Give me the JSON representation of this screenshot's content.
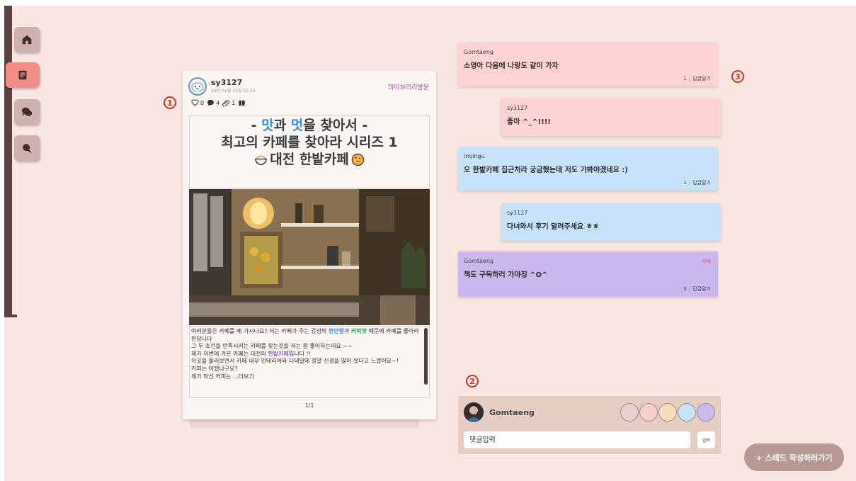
{
  "sidebar": {
    "items": [
      {
        "icon": "home-icon",
        "active": false
      },
      {
        "icon": "document-icon",
        "active": true
      },
      {
        "icon": "chat-icon",
        "active": false
      },
      {
        "icon": "search-icon",
        "active": false
      }
    ]
  },
  "post": {
    "user": "sy3127",
    "date": "24년 02월 15일 15:24",
    "visit_label": "마이브러리방문",
    "stats": {
      "likes": "0",
      "comments": "4",
      "clips": "1"
    },
    "title": {
      "line1_pre": "- ",
      "line1_mat": "맛",
      "line1_mid": "과 ",
      "line1_meot": "멋",
      "line1_post": "을 찾아서 -",
      "line2": "최고의 카페를 찾아라 시리즈 1",
      "line3": "대전 한밭카페"
    },
    "body": {
      "p1_a": "여러분들은 카페를 왜 가시나요? 저는 카페가 주는 감성의 ",
      "p1_b": "편안함",
      "p1_c": "과 ",
      "p1_d": "커피맛",
      "p1_e": " 때문에 카페를 좋아라 한답니다",
      "p2": "그 두 조건을 만족시키는 카페를 찾는것을 저는 참 좋아하는데요 ~~",
      "p3_a": "제가 이번에 가본 카페는 대전의 ",
      "p3_b": "한밭카페",
      "p3_c": "입니다 !!",
      "p4": "이곳을 둘러보면서 카페 내부 인테리어와 디테일에 정말 신경을 많이 썼다고 느꼈어요~!",
      "p5": "커피는 어땠냐구요?",
      "p6": "제가 마신 커피는 ...더보기"
    },
    "pages": "1/1"
  },
  "markers": {
    "m1": "1",
    "m2": "2",
    "m3": "3"
  },
  "comments": [
    {
      "user": "Gomtaeng",
      "text": "소영아 다음에 나랑도 같이 가자",
      "count": "1",
      "reply": "답글달기"
    },
    {
      "user": "sy3127",
      "text": "좋아 ^_^!!!!"
    },
    {
      "user": "imjingu",
      "text": "오 한밭카페 집근처라 궁금했는데 저도 가봐야겠네요 :)",
      "count": "1",
      "reply": "답글달기"
    },
    {
      "user": "sy3127",
      "text": "다녀와서 후기 알려주세요 ㅎㅎ"
    },
    {
      "user": "Gomtaeng",
      "text": "책도 구독하러 가야징 ^O^",
      "count": "0",
      "reply": "답글달기",
      "delete": "삭제"
    }
  ],
  "comment_box": {
    "user": "Gomtaeng",
    "swatches": [
      "#e9d1cd",
      "#f8cfcf",
      "#f7dcc0",
      "#c8e3f8",
      "#cdb9ee"
    ],
    "placeholder": "댓글입력",
    "submit": "입력"
  },
  "thread_button": "+ 스레드 작성하러가기",
  "colors": {
    "background": "#f9e6e2",
    "rail": "#5b4341",
    "nav_active": "#f08d86",
    "comment_pink": "#fed3d2",
    "comment_blue": "#c7e2fb",
    "comment_purple": "#cbb7ee",
    "marker": "#c93a1f"
  }
}
